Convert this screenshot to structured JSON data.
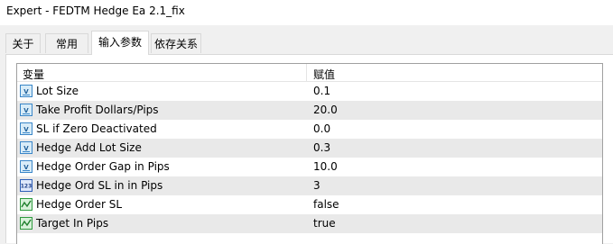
{
  "window": {
    "title": "Expert - FEDTM Hedge Ea 2.1_fix"
  },
  "tabs": [
    {
      "label": "关于"
    },
    {
      "label": "常用"
    },
    {
      "label": "输入参数",
      "active": true
    },
    {
      "label": "依存关系"
    }
  ],
  "table": {
    "headers": {
      "variable": "变量",
      "value": "赋值"
    },
    "rows": [
      {
        "name": "Lot Size",
        "value": "0.1",
        "icon": "double-value-icon"
      },
      {
        "name": "Take Profit Dollars/Pips",
        "value": "20.0",
        "icon": "double-value-icon"
      },
      {
        "name": "SL if Zero Deactivated",
        "value": "0.0",
        "icon": "double-value-icon"
      },
      {
        "name": "Hedge Add Lot Size",
        "value": "0.3",
        "icon": "double-value-icon"
      },
      {
        "name": "Hedge Order Gap in Pips",
        "value": "10.0",
        "icon": "double-value-icon"
      },
      {
        "name": "Hedge Ord SL in in Pips",
        "value": "3",
        "icon": "integer-value-icon"
      },
      {
        "name": "Hedge Order SL",
        "value": "false",
        "icon": "boolean-value-icon"
      },
      {
        "name": "Target In Pips",
        "value": "true",
        "icon": "boolean-value-icon"
      }
    ]
  },
  "colors": {
    "row_alt": "#e9e9e9",
    "grid_border": "#a0a0a0"
  }
}
